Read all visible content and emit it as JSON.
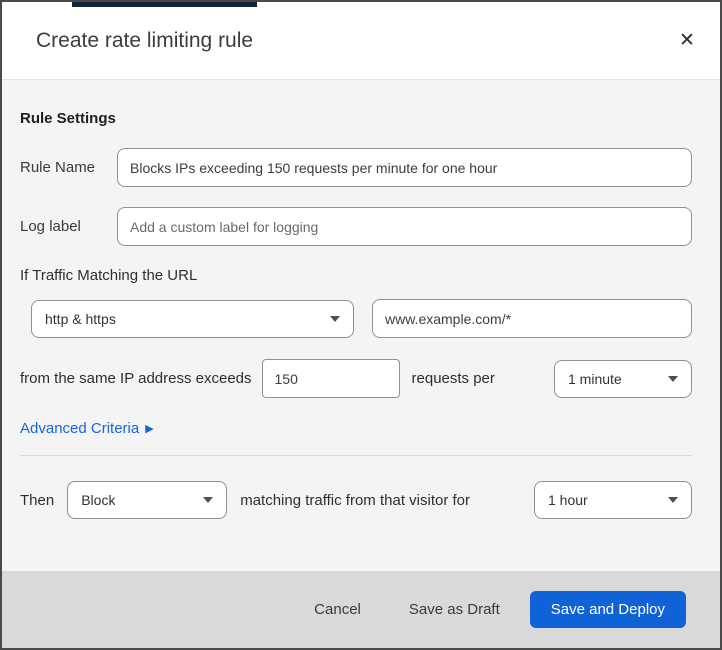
{
  "colors": {
    "top_bar": "#0f2437",
    "link": "#1766d8",
    "primary_button": "#1063d7"
  },
  "dialog": {
    "title": "Create rate limiting rule",
    "close_icon": "✕"
  },
  "rule_settings": {
    "heading": "Rule Settings",
    "rule_name": {
      "label": "Rule Name",
      "value": "Blocks IPs exceeding 150 requests per minute for one hour"
    },
    "log_label": {
      "label": "Log label",
      "placeholder": "Add a custom label for logging"
    },
    "traffic_heading": "If Traffic Matching the URL",
    "scheme_select_value": "http & https",
    "url_value": "www.example.com/*",
    "threshold": {
      "text_before": "from the same IP address exceeds",
      "requests_value": "150",
      "text_between": "requests per",
      "period_select_value": "1 minute"
    },
    "advanced_criteria_label": "Advanced Criteria",
    "advanced_criteria_arrow": "▶",
    "then": {
      "label": "Then",
      "action_select_value": "Block",
      "text_between": "matching traffic from that visitor for",
      "duration_select_value": "1 hour"
    }
  },
  "footer": {
    "cancel_label": "Cancel",
    "save_draft_label": "Save as Draft",
    "save_deploy_label": "Save and Deploy"
  }
}
